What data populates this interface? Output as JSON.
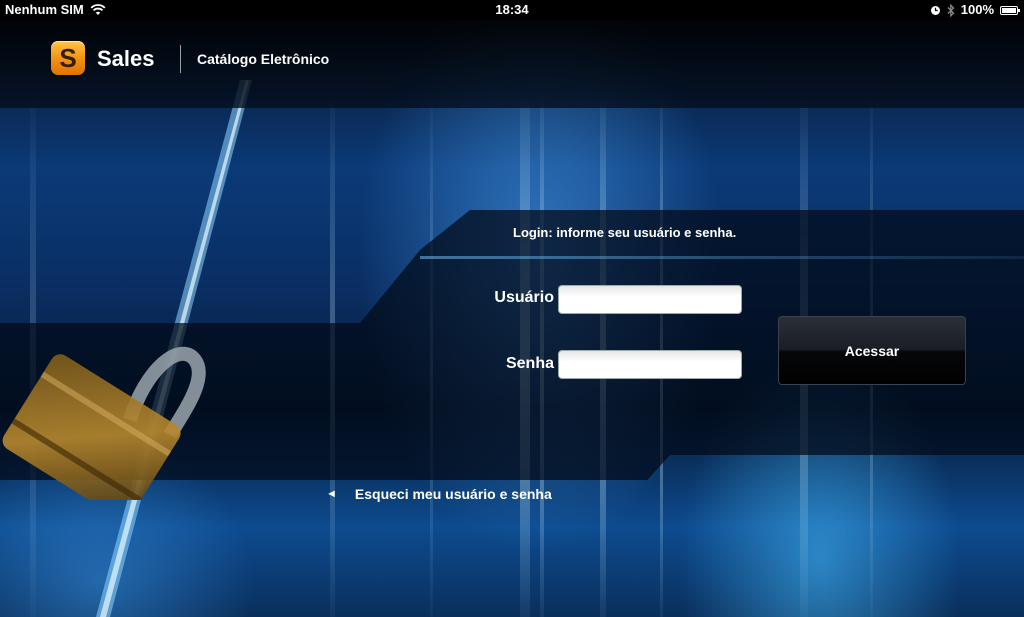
{
  "status_bar": {
    "carrier": "Nenhum SIM",
    "time": "18:34",
    "battery": "100%"
  },
  "header": {
    "logo_letter": "S",
    "app_name": "Sales",
    "subtitle": "Catálogo Eletrônico"
  },
  "login": {
    "title": "Login: informe seu usuário e senha.",
    "username_label": "Usuário",
    "username_value": "",
    "password_label": "Senha",
    "password_value": "",
    "submit_label": "Acessar",
    "forgot_label": "Esqueci meu usuário e senha",
    "forgot_arrow": "◄"
  },
  "colors": {
    "background_blue": "#0b3a78",
    "logo_orange": "#f39412",
    "text": "#ffffff"
  }
}
